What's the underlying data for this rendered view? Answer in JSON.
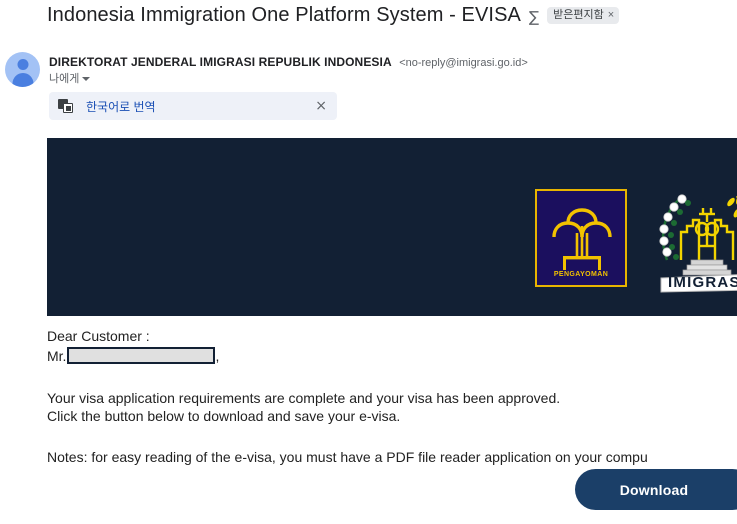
{
  "email": {
    "subject": "Indonesia Immigration One Platform System - EVISA",
    "inbox_icon": "inbox-icon",
    "label_chip": {
      "text": "받은편지함",
      "close": "×"
    },
    "sender": {
      "avatar_icon": "person-avatar-icon",
      "name": "DIREKTORAT JENDERAL IMIGRASI REPUBLIK INDONESIA",
      "address": "<no-reply@imigrasi.go.id>",
      "recipient": "나에게",
      "expand_icon": "chevron-down-icon"
    },
    "translate_bar": {
      "icon": "translate-icon",
      "label": "한국어로 번역",
      "close": "×"
    },
    "banner": {
      "background_color": "#122034",
      "logos": [
        {
          "name": "pengayoman-logo",
          "caption": "PENGAYOMAN",
          "frame_color": "#e8b400",
          "field_color": "#1b0f5e"
        },
        {
          "name": "imigrasi-emblem",
          "caption": "IMIGRASI",
          "accent_color": "#f2d400"
        }
      ]
    },
    "body": {
      "salutation": "Dear Customer :",
      "name_prefix": "Mr.",
      "name_redacted": "",
      "name_suffix": ",",
      "paragraph_line_1": "Your visa application requirements are complete and your visa has been approved.",
      "paragraph_line_2": "Click the button below to download and save your e-visa.",
      "notes": "Notes: for easy reading of the e-visa, you must have a PDF file reader application on your compu"
    },
    "download_button": {
      "label": "Download",
      "color": "#1b3f68"
    }
  }
}
